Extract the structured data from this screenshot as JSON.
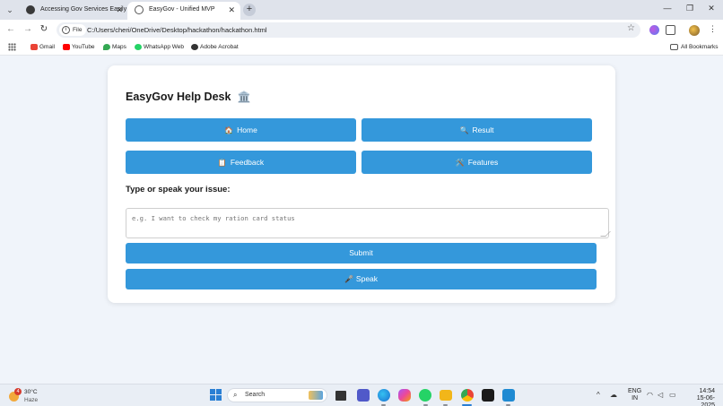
{
  "browser": {
    "tabs": [
      {
        "title": "Accessing Gov Services Easily",
        "active": false
      },
      {
        "title": "EasyGov - Unified MVP",
        "active": true
      }
    ],
    "new_tab": "+",
    "window_controls": {
      "minimize": "—",
      "restore": "❐",
      "close": "✕"
    },
    "nav": {
      "back": "←",
      "forward": "→",
      "reload": "↻"
    },
    "address": {
      "scheme_chip": "File",
      "url": "C:/Users/cheri/OneDrive/Desktop/hackathon/hackathon.html"
    },
    "bookmarks": [
      {
        "label": "Gmail",
        "color": "#ea4335"
      },
      {
        "label": "YouTube",
        "color": "#ff0000"
      },
      {
        "label": "Maps",
        "color": "#34a853"
      },
      {
        "label": "WhatsApp Web",
        "color": "#25d366"
      },
      {
        "label": "Adobe Acrobat",
        "color": "#333333"
      }
    ],
    "all_bookmarks": "All Bookmarks"
  },
  "page": {
    "title": "EasyGov Help Desk",
    "title_icon": "🏛️",
    "nav_buttons": [
      {
        "label": "Home",
        "icon": "🏠"
      },
      {
        "label": "Result",
        "icon": "🔍"
      },
      {
        "label": "Feedback",
        "icon": "📋"
      },
      {
        "label": "Features",
        "icon": "🛠️"
      }
    ],
    "prompt": "Type or speak your issue:",
    "input_placeholder": "e.g. I want to check my ration card status",
    "submit_label": "Submit",
    "speak_label": "Speak",
    "speak_icon": "🎤",
    "accent_color": "#3498db"
  },
  "taskbar": {
    "weather": {
      "temp": "30°C",
      "condition": "Haze",
      "badge": "4"
    },
    "search_placeholder": "Search",
    "language": {
      "line1": "ENG",
      "line2": "IN"
    },
    "clock": {
      "time": "14:54",
      "date": "15-06-2025"
    }
  }
}
